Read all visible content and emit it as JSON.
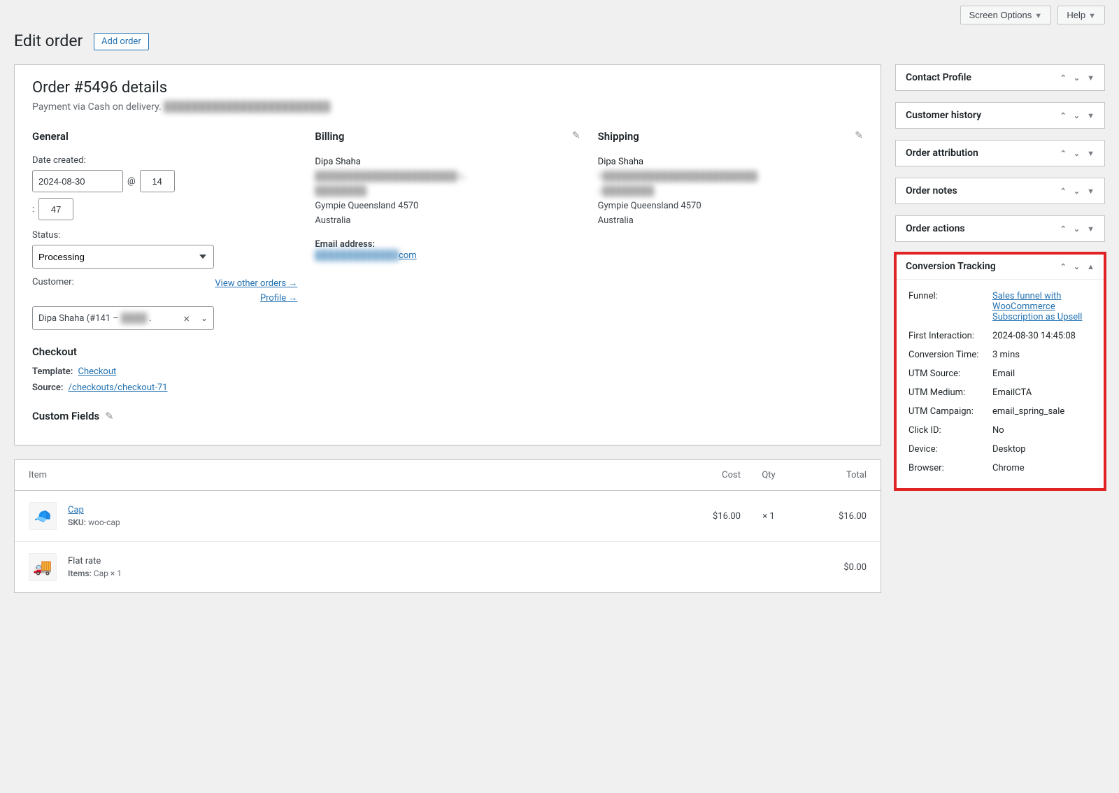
{
  "top": {
    "screen_options": "Screen Options",
    "help": "Help"
  },
  "page": {
    "title": "Edit order",
    "add_order": "Add order"
  },
  "order": {
    "heading": "Order #5496 details",
    "payment": "Payment via Cash on delivery.",
    "payment_blur": "████████████████████████"
  },
  "general": {
    "heading": "General",
    "date_label": "Date created:",
    "date": "2024-08-30",
    "hour": "14",
    "minute": "47",
    "status_label": "Status:",
    "status": "Processing",
    "customer_label": "Customer:",
    "view_other": "View other orders →",
    "profile": "Profile →",
    "customer": "Dipa Shaha (#141 – ",
    "customer_blur": "████"
  },
  "billing": {
    "heading": "Billing",
    "name": "Dipa Shaha",
    "line_blur1": "██████████████████████la,",
    "line_blur2": "████████",
    "city": "Gympie Queensland 4570",
    "country": "Australia",
    "email_label": "Email address:",
    "email_blur": "█████████████",
    "email_suffix": "com"
  },
  "shipping": {
    "heading": "Shipping",
    "name": "Dipa Shaha",
    "line_blur1": "8████████████████████████",
    "line_blur2": "c████████",
    "city": "Gympie Queensland 4570",
    "country": "Australia"
  },
  "checkout": {
    "heading": "Checkout",
    "template_label": "Template:",
    "template_link": "Checkout",
    "source_label": "Source:",
    "source_link": "/checkouts/checkout-71"
  },
  "customfields": {
    "heading": "Custom Fields"
  },
  "items_table": {
    "h_item": "Item",
    "h_cost": "Cost",
    "h_qty": "Qty",
    "h_total": "Total",
    "item1": {
      "name": "Cap",
      "sku_label": "SKU:",
      "sku": "woo-cap",
      "cost": "$16.00",
      "qty": "× 1",
      "total": "$16.00",
      "emoji": "🧢"
    },
    "item2": {
      "name": "Flat rate",
      "items_label": "Items:",
      "items": "Cap × 1",
      "total": "$0.00"
    }
  },
  "sidebar": {
    "contact": "Contact Profile",
    "history": "Customer history",
    "attribution": "Order attribution",
    "notes": "Order notes",
    "actions": "Order actions",
    "conversion": "Conversion Tracking"
  },
  "ct": {
    "funnel_k": "Funnel:",
    "funnel_v": "Sales funnel with WooCommerce Subscription as Upsell",
    "first_k": "First Interaction:",
    "first_v": "2024-08-30 14:45:08",
    "conv_k": "Conversion Time:",
    "conv_v": "3 mins",
    "source_k": "UTM Source:",
    "source_v": "Email",
    "medium_k": "UTM Medium:",
    "medium_v": "EmailCTA",
    "campaign_k": "UTM Campaign:",
    "campaign_v": "email_spring_sale",
    "click_k": "Click ID:",
    "click_v": "No",
    "device_k": "Device:",
    "device_v": "Desktop",
    "browser_k": "Browser:",
    "browser_v": "Chrome"
  }
}
